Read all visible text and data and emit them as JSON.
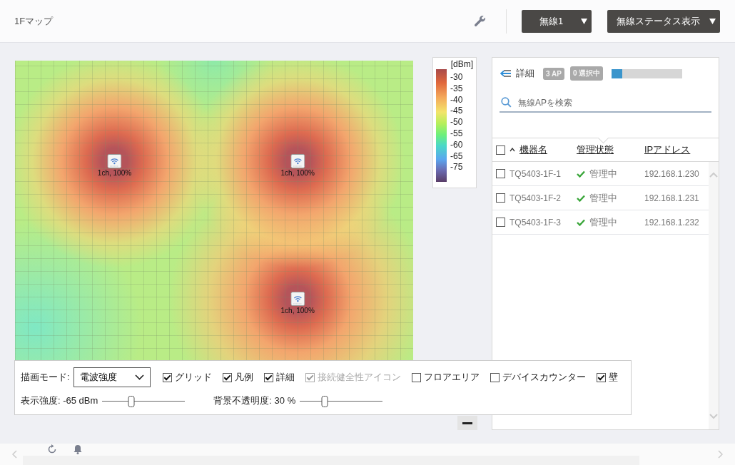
{
  "header": {
    "title": "1Fマップ",
    "dropdowns": [
      "無線1",
      "無線ステータス表示"
    ]
  },
  "map": {
    "access_points": [
      {
        "label": "1ch, 100%"
      },
      {
        "label": "1ch, 100%"
      },
      {
        "label": "1ch, 100%"
      }
    ]
  },
  "legend": {
    "unit": "[dBm]",
    "labels": [
      "-30",
      "-35",
      "-40",
      "-45",
      "-50",
      "-55",
      "-60",
      "-65",
      "-75"
    ]
  },
  "controls": {
    "mode_label": "描画モード:",
    "mode_value": "電波強度",
    "options": [
      {
        "label": "グリッド",
        "checked": true,
        "disabled": false
      },
      {
        "label": "凡例",
        "checked": true,
        "disabled": false
      },
      {
        "label": "詳細",
        "checked": true,
        "disabled": false
      },
      {
        "label": "接続健全性アイコン",
        "checked": true,
        "disabled": true
      },
      {
        "label": "フロアエリア",
        "checked": false,
        "disabled": false
      },
      {
        "label": "デバイスカウンター",
        "checked": false,
        "disabled": false
      },
      {
        "label": "壁",
        "checked": true,
        "disabled": false
      }
    ],
    "sliders": [
      {
        "label": "表示強度: -65 dBm",
        "level": 0.35
      },
      {
        "label": "背景不透明度: 30 %",
        "level": 0.3
      }
    ]
  },
  "panel": {
    "title": "詳細",
    "badges": [
      "3 AP",
      "0 選択中"
    ],
    "progress": {
      "level": 0.15
    },
    "search": {
      "placeholder": "無線APを検索"
    },
    "columns": [
      "機器名",
      "管理状態",
      "IPアドレス"
    ],
    "select_all": {
      "checked": false
    },
    "rows": [
      {
        "checked": false,
        "name": "TQ5403-1F-1",
        "status": "管理中",
        "ip": "192.168.1.230"
      },
      {
        "checked": false,
        "name": "TQ5403-1F-2",
        "status": "管理中",
        "ip": "192.168.1.231"
      },
      {
        "checked": false,
        "name": "TQ5403-1F-3",
        "status": "管理中",
        "ip": "192.168.1.232"
      }
    ]
  }
}
